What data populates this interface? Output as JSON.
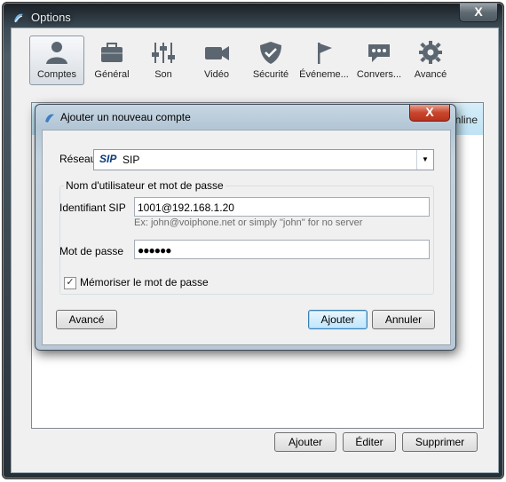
{
  "window": {
    "title": "Options",
    "close_symbol": "X"
  },
  "toolbar": {
    "items": [
      {
        "label": "Comptes",
        "icon": "user-icon",
        "active": true
      },
      {
        "label": "Général",
        "icon": "briefcase-icon"
      },
      {
        "label": "Son",
        "icon": "sliders-icon"
      },
      {
        "label": "Vidéo",
        "icon": "camera-icon"
      },
      {
        "label": "Sécurité",
        "icon": "shield-icon"
      },
      {
        "label": "Événeme...",
        "icon": "flag-icon"
      },
      {
        "label": "Convers...",
        "icon": "chat-icon"
      },
      {
        "label": "Avancé",
        "icon": "gear-icon"
      }
    ]
  },
  "background_panel": {
    "peek_text": "nline"
  },
  "bottom_buttons": {
    "add": "Ajouter",
    "edit": "Éditer",
    "delete": "Supprimer"
  },
  "dialog": {
    "title": "Ajouter un nouveau compte",
    "close_symbol": "X",
    "network_label": "Réseau",
    "network_logo": "SIP",
    "network_value": "SIP",
    "group_title": "Nom d'utilisateur et mot de passe",
    "sip_id_label": "Identifiant SIP",
    "sip_id_value": "1001@192.168.1.20",
    "sip_id_hint": "Ex: john@voiphone.net or simply \"john\" for no server",
    "password_label": "Mot de passe",
    "password_value": "●●●●●●",
    "remember_label": "Mémoriser le mot de passe",
    "remember_checked": true,
    "check_mark": "✓",
    "advanced_button": "Avancé",
    "add_button": "Ajouter",
    "cancel_button": "Annuler"
  },
  "colors": {
    "header_blue": "#bfe3f4",
    "sip_blue": "#0b3a78",
    "close_red": "#c9452b"
  }
}
